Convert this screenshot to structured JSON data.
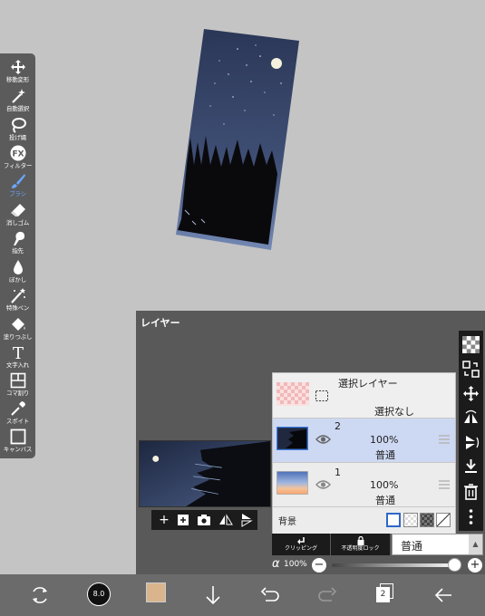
{
  "toolbar": {
    "tools": [
      {
        "label": "移動変形",
        "icon": "move-icon"
      },
      {
        "label": "自動選択",
        "icon": "magic-wand-icon"
      },
      {
        "label": "投げ縄",
        "icon": "lasso-icon"
      },
      {
        "label": "フィルター",
        "icon": "filter-icon",
        "glyph": "FX"
      },
      {
        "label": "ブラシ",
        "icon": "brush-icon"
      },
      {
        "label": "消しゴム",
        "icon": "eraser-icon"
      },
      {
        "label": "指先",
        "icon": "smudge-icon"
      },
      {
        "label": "ぼかし",
        "icon": "blur-icon"
      },
      {
        "label": "特殊ペン",
        "icon": "special-pen-icon"
      },
      {
        "label": "塗りつぶし",
        "icon": "bucket-icon"
      },
      {
        "label": "文字入れ",
        "icon": "text-icon",
        "glyph": "T"
      },
      {
        "label": "コマ割り",
        "icon": "frame-divider-icon"
      },
      {
        "label": "スポイト",
        "icon": "eyedropper-icon"
      },
      {
        "label": "キャンバス",
        "icon": "canvas-icon"
      }
    ],
    "active_tool": "ブラシ",
    "active_color": "#6aa7ff"
  },
  "layer_panel": {
    "title": "レイヤー",
    "selection_layer": {
      "title": "選択レイヤー",
      "status": "選択なし"
    },
    "layers": [
      {
        "number": "2",
        "opacity": "100%",
        "blend": "普通",
        "selected": true
      },
      {
        "number": "1",
        "opacity": "100%",
        "blend": "普通",
        "selected": false
      }
    ],
    "background": {
      "label": "背景"
    },
    "clipping_label": "クリッピング",
    "opacity_lock_label": "不透明度ロック",
    "blend_mode": "普通",
    "alpha": {
      "symbol": "α",
      "value": "100%",
      "level": 1.0,
      "minus": "−",
      "plus": "+"
    }
  },
  "mini_bar": {
    "add_glyph": "+"
  },
  "bottom_bar": {
    "brush_size": "8.0",
    "color_swatch": "#d9b48c",
    "layer_count": "2"
  },
  "colors": {
    "panel": "#595959",
    "selected_row": "#cdd8f2",
    "sky_top": "#2d3a5c",
    "sky_bottom": "#5a6e96"
  }
}
